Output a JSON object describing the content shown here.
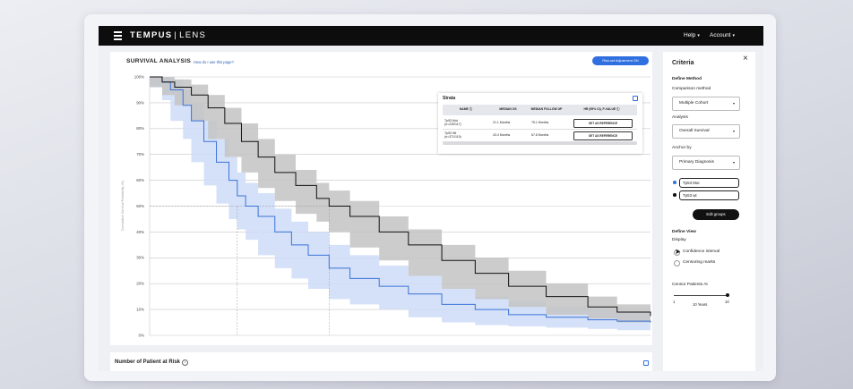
{
  "header": {
    "brand": "TEMPUS",
    "brand_sub": "LENS",
    "nav": [
      "Help",
      "Account"
    ]
  },
  "panel": {
    "title": "SURVIVAL ANALYSIS",
    "help_link": "How do I use this page?",
    "risk_button": "Risk-set Adjustment ON",
    "y_axis_label": "Cumulative Survival Probability (%)"
  },
  "strata": {
    "title": "Strata",
    "columns": [
      "NAME",
      "MEDIAN OS",
      "MEDIAN FOLLOW UP",
      "HR (95% CI), P-VALUE"
    ],
    "rows": [
      {
        "name": "Tp53 Mut",
        "n": "(n=225/117)",
        "median_os": "21.1 Months",
        "median_fu": "75.1 Months",
        "action": "SET AS REFERENCE"
      },
      {
        "name": "Tp53 Wt",
        "n": "(n=371/119)",
        "median_os": "43.4 Months",
        "median_fu": "67.8 Months",
        "action": "SET AS REFERENCE"
      }
    ]
  },
  "risk_panel": {
    "title": "Number of Patient at Risk"
  },
  "criteria": {
    "title": "Criteria",
    "define_method": "Define Method",
    "comparison_label": "Comparison method",
    "comparison_value": "Multiple Cohort",
    "analysis_label": "Analysis",
    "analysis_value": "Overall Survival",
    "anchor_label": "Anchor by",
    "anchor_value": "Primary Diagnosis",
    "groups": [
      {
        "name": "Tp53 Mut",
        "color": "#3b73d9"
      },
      {
        "name": "Tp53 wt",
        "color": "#111111"
      }
    ],
    "edit_groups": "Edit groups",
    "define_view": "Define View",
    "display_label": "Display",
    "options": [
      "Confidence interval",
      "Censoring marks"
    ],
    "censor_label": "Censor Patients At",
    "slider_min": "1",
    "slider_max": "10",
    "slider_value_label": "10 Years",
    "slider_value": 10
  },
  "colors": {
    "accent": "#2f6fe0",
    "mut_line": "#3b73d9",
    "mut_band": "#cddcf7",
    "wt_line": "#111111",
    "wt_band": "#c3c3c3"
  },
  "chart_data": {
    "type": "line",
    "ylabel": "Cumulative Survival Probability (%)",
    "yticks": [
      "100%",
      "90%",
      "80%",
      "70%",
      "60%",
      "50%",
      "40%",
      "30%",
      "20%",
      "10%",
      "0%"
    ],
    "ylim": [
      0,
      100
    ],
    "xlim": [
      0,
      120
    ],
    "x_unit": "months",
    "grid": true,
    "median_reference": 50,
    "series": [
      {
        "name": "Tp53 Mut",
        "color": "#3b73d9",
        "x": [
          0,
          3,
          5,
          8,
          10,
          13,
          16,
          19,
          21,
          23,
          26,
          30,
          34,
          38,
          43,
          48,
          55,
          62,
          70,
          78,
          86,
          95,
          105,
          112,
          120
        ],
        "y": [
          100,
          98,
          95,
          89,
          83,
          75,
          67,
          60,
          54,
          50,
          46,
          40,
          35,
          31,
          26,
          22,
          19,
          16,
          12,
          10,
          8,
          7,
          6,
          5.5,
          5
        ],
        "lower": [
          100,
          96,
          91,
          83,
          76,
          67,
          58,
          51,
          45,
          41,
          37,
          31,
          26,
          22,
          18,
          14,
          12,
          10,
          7,
          5,
          4,
          3.5,
          3,
          2.5,
          2
        ],
        "upper": [
          100,
          100,
          99,
          95,
          90,
          83,
          76,
          69,
          63,
          59,
          55,
          49,
          44,
          40,
          35,
          31,
          27,
          23,
          18,
          15,
          13,
          11,
          10,
          9,
          8.5
        ]
      },
      {
        "name": "Tp53 wt",
        "color": "#111111",
        "x": [
          0,
          3,
          6,
          10,
          14,
          18,
          22,
          26,
          30,
          35,
          40,
          43,
          48,
          55,
          62,
          70,
          78,
          86,
          95,
          105,
          112,
          120
        ],
        "y": [
          100,
          98,
          96,
          93,
          88,
          82,
          75,
          69,
          63,
          58,
          53,
          50,
          46,
          40,
          35,
          29,
          24,
          19,
          15,
          11,
          9,
          7.5
        ],
        "lower": [
          100,
          96,
          93,
          89,
          83,
          76,
          69,
          63,
          57,
          52,
          47,
          44,
          40,
          34,
          29,
          23,
          18,
          14,
          11,
          8,
          6.5,
          5
        ],
        "upper": [
          100,
          100,
          99,
          97,
          93,
          88,
          82,
          76,
          70,
          64,
          59,
          56,
          52,
          46,
          41,
          35,
          30,
          25,
          20,
          15,
          12,
          10
        ]
      }
    ],
    "median_lines_x": [
      21,
      43
    ]
  }
}
